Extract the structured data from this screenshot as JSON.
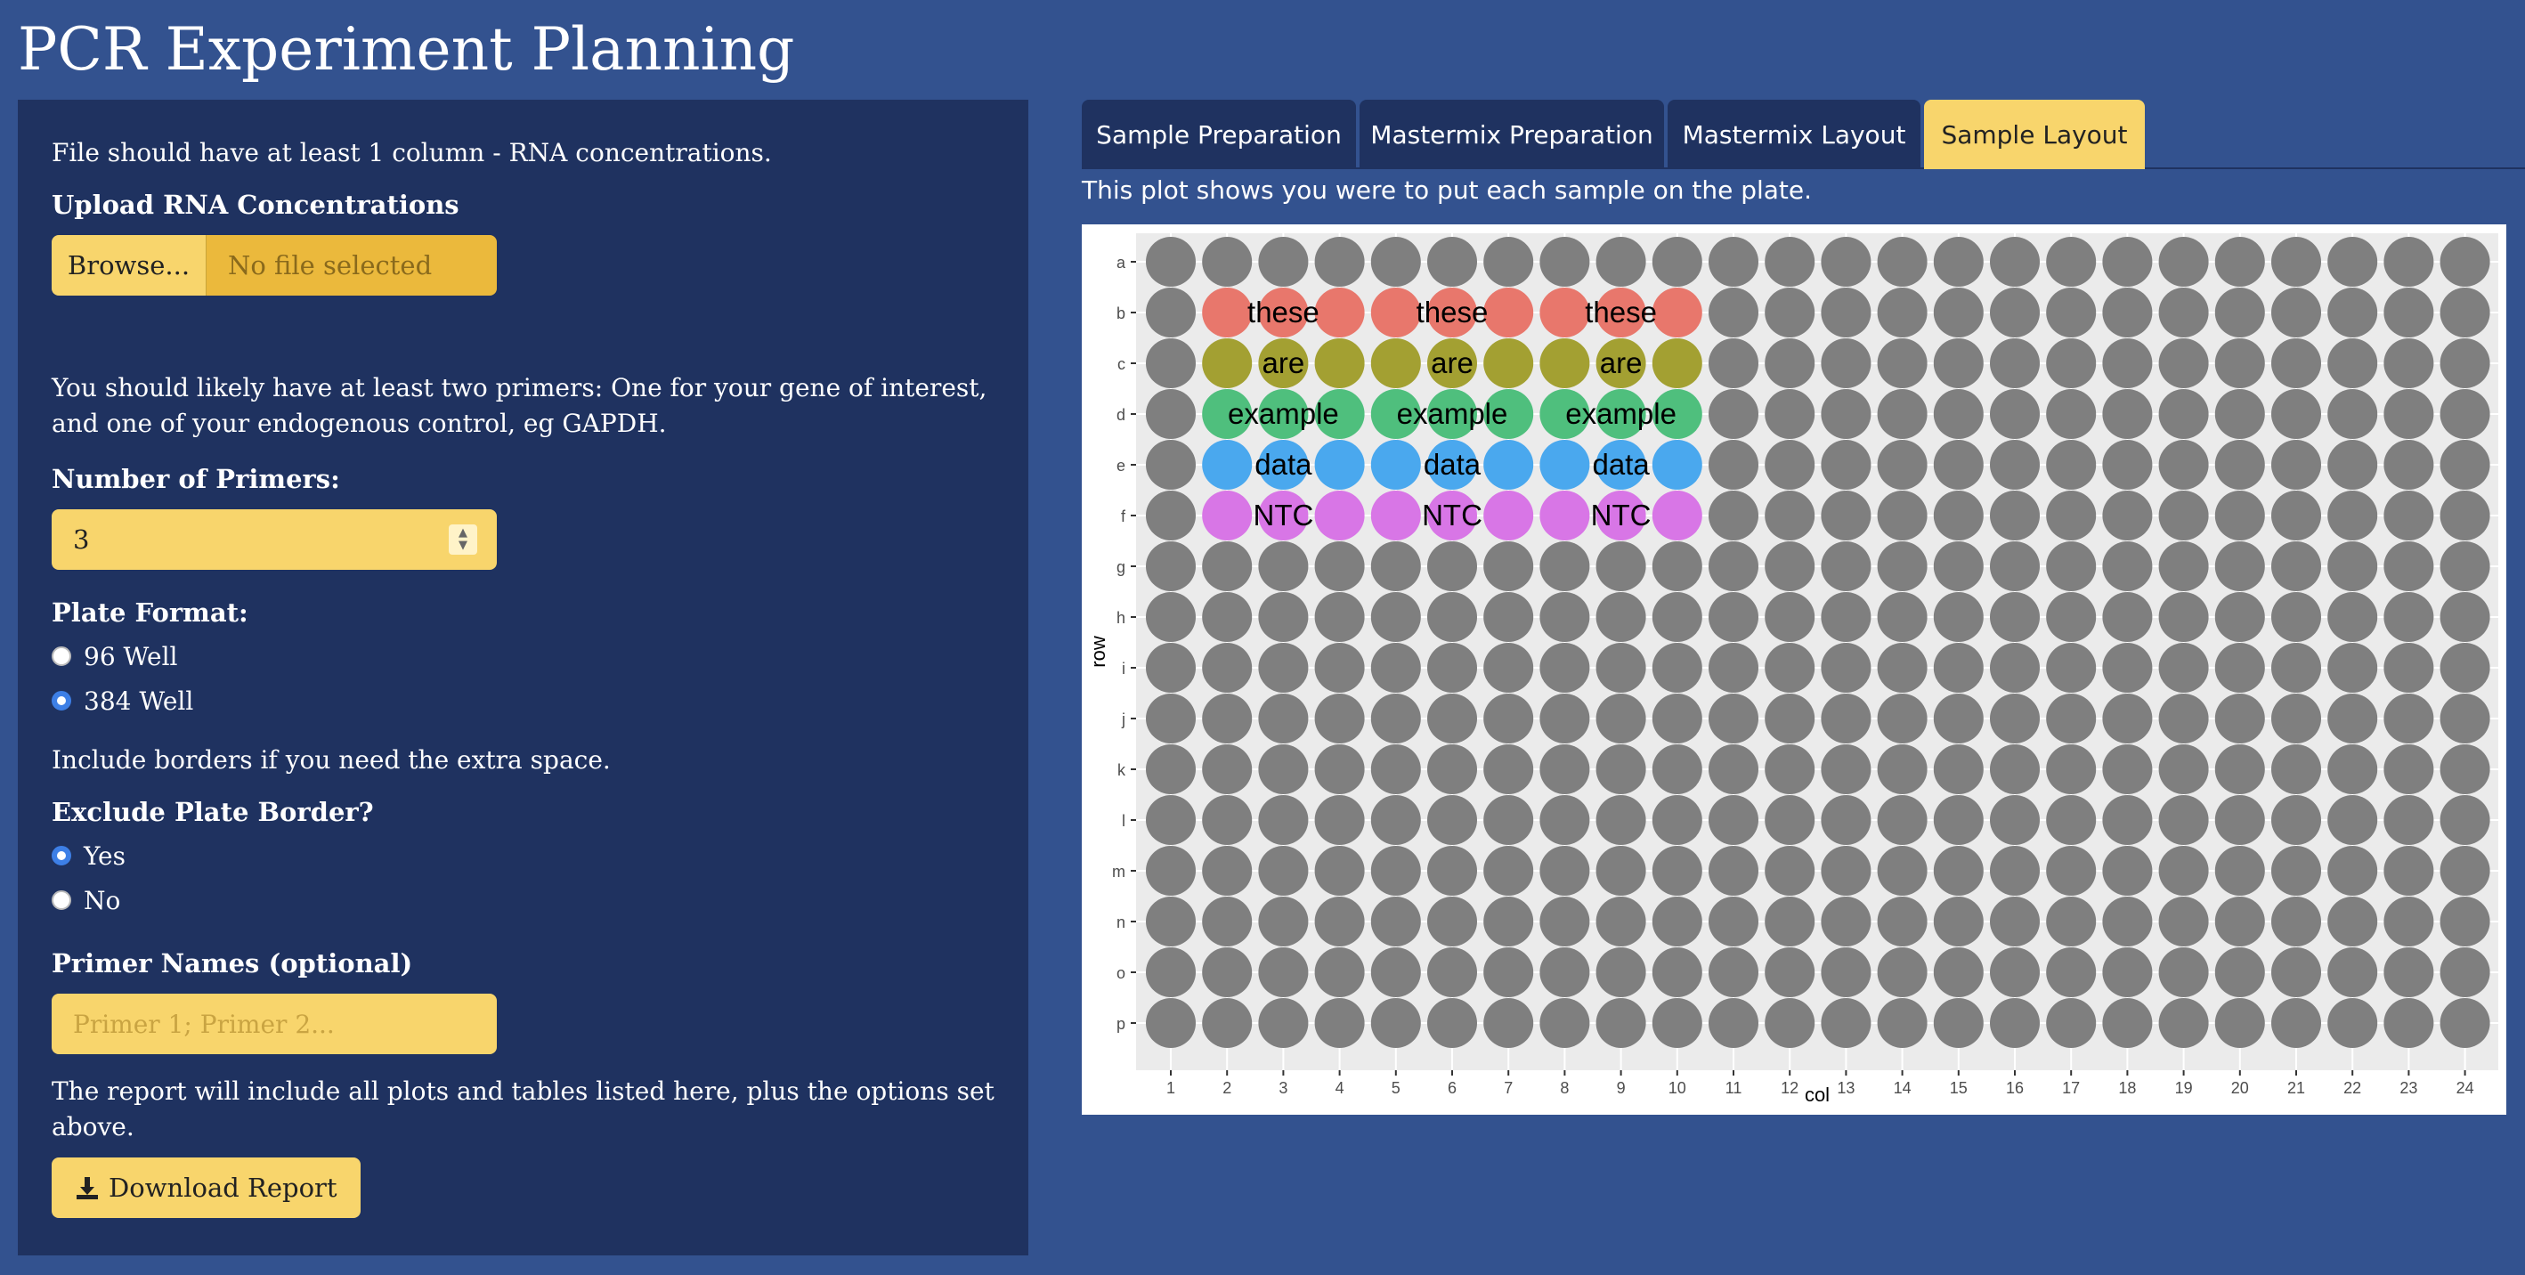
{
  "app": {
    "title": "PCR Experiment Planning"
  },
  "sidebar": {
    "file_help": "File should have at least 1 column - RNA concentrations.",
    "upload_label": "Upload RNA Concentrations",
    "browse_label": "Browse...",
    "file_placeholder": "No file selected",
    "primer_help": "You should likely have at least two primers: One for your gene of interest, and one of your endogenous control, eg GAPDH.",
    "primers_label": "Number of Primers:",
    "primers_value": "3",
    "plate_format_label": "Plate Format:",
    "plate_options": [
      "96 Well",
      "384 Well"
    ],
    "plate_selected": "384 Well",
    "border_help": "Include borders if you need the extra space.",
    "border_label": "Exclude Plate Border?",
    "border_options": [
      "Yes",
      "No"
    ],
    "border_selected": "Yes",
    "primer_names_label": "Primer Names (optional)",
    "primer_names_placeholder": "Primer 1; Primer 2...",
    "report_help": "The report will include all plots and tables listed here, plus the options set above.",
    "download_label": "Download Report"
  },
  "tabs": [
    "Sample Preparation",
    "Mastermix Preparation",
    "Mastermix Layout",
    "Sample Layout"
  ],
  "active_tab": "Sample Layout",
  "plot": {
    "caption": "This plot shows you were to put each sample on the plate."
  },
  "icons": {
    "download": "download-icon",
    "spinner": "number-spinner-icon"
  },
  "colors": {
    "empty": "#7f7f7f",
    "these": "#e8776c",
    "are": "#a3a032",
    "example": "#4fbf7d",
    "data": "#4aa8ee",
    "NTC": "#d876e6",
    "panel_bg": "#ebebeb"
  },
  "chart_data": {
    "type": "scatter",
    "xlabel": "col",
    "ylabel": "row",
    "x_ticks": [
      "1",
      "2",
      "3",
      "4",
      "5",
      "6",
      "7",
      "8",
      "9",
      "10",
      "11",
      "12",
      "13",
      "14",
      "15",
      "16",
      "17",
      "18",
      "19",
      "20",
      "21",
      "22",
      "23",
      "24"
    ],
    "y_ticks": [
      "a",
      "b",
      "c",
      "d",
      "e",
      "f",
      "g",
      "h",
      "i",
      "j",
      "k",
      "l",
      "m",
      "n",
      "o",
      "p"
    ],
    "filled_cols": [
      2,
      3,
      4,
      5,
      6,
      7,
      8,
      9,
      10
    ],
    "sample_rows": [
      {
        "row": "b",
        "label": "these",
        "color": "#e8776c"
      },
      {
        "row": "c",
        "label": "are",
        "color": "#a3a032"
      },
      {
        "row": "d",
        "label": "example",
        "color": "#4fbf7d"
      },
      {
        "row": "e",
        "label": "data",
        "color": "#4aa8ee"
      },
      {
        "row": "f",
        "label": "NTC",
        "color": "#d876e6"
      }
    ],
    "label_cols": [
      3,
      6,
      9
    ],
    "legend": "none",
    "grid": true
  }
}
